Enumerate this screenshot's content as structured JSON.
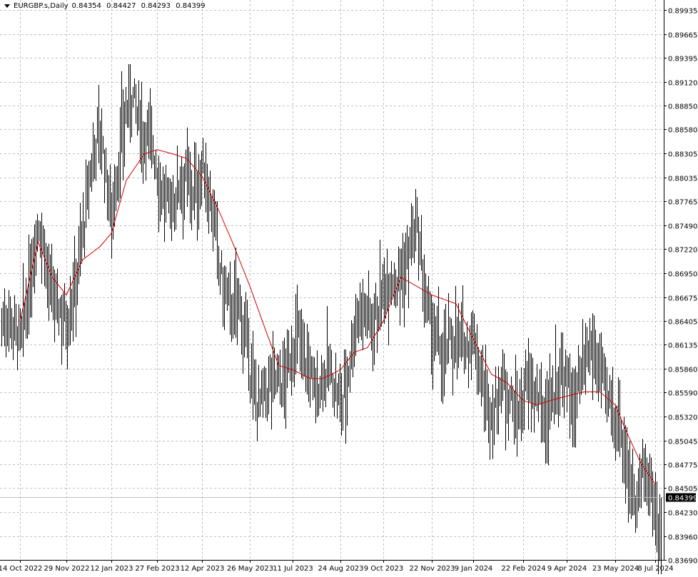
{
  "header": {
    "symbol_label": "EURGBP.s,Daily",
    "open": "0.84354",
    "high": "0.84427",
    "low": "0.84293",
    "close": "0.84399"
  },
  "colors": {
    "background": "#ffffff",
    "grid": "#c0c0c0",
    "bars": "#000000",
    "moving_average": "#d00000",
    "current_price_line": "#c0c0c0",
    "price_label_bg": "#000000",
    "price_label_text": "#ffffff"
  },
  "chart_data": {
    "type": "ohlc",
    "symbol": "EURGBP.s",
    "timeframe": "Daily",
    "grid": true,
    "last_price": 0.84399,
    "ylim": [
      0.8369,
      0.9005
    ],
    "y_ticks": [
      "0.89935",
      "0.89665",
      "0.89395",
      "0.89120",
      "0.88850",
      "0.88580",
      "0.88305",
      "0.88035",
      "0.87765",
      "0.87490",
      "0.87220",
      "0.86950",
      "0.86675",
      "0.86405",
      "0.86135",
      "0.85860",
      "0.85590",
      "0.85320",
      "0.85045",
      "0.84775",
      "0.84505",
      "0.84230",
      "0.83960",
      "0.83690"
    ],
    "x_ticks": [
      "14 Oct 2022",
      "29 Nov 2022",
      "12 Jan 2023",
      "27 Feb 2023",
      "12 Apr 2023",
      "26 May 2023",
      "11 Jul 2023",
      "24 Aug 2023",
      "9 Oct 2023",
      "22 Nov 2023",
      "9 Jan 2024",
      "22 Feb 2024",
      "9 Apr 2024",
      "23 May 2024",
      "8 Jul 2024"
    ],
    "price_points": [
      {
        "date": "14 Oct 2022",
        "price": 0.863
      },
      {
        "date": "1 Nov 2022",
        "price": 0.874
      },
      {
        "date": "15 Nov 2022",
        "price": 0.868
      },
      {
        "date": "29 Nov 2022",
        "price": 0.862
      },
      {
        "date": "15 Dec 2022",
        "price": 0.876
      },
      {
        "date": "1 Jan 2023",
        "price": 0.885
      },
      {
        "date": "12 Jan 2023",
        "price": 0.878
      },
      {
        "date": "3 Feb 2023",
        "price": 0.89
      },
      {
        "date": "14 Feb 2023",
        "price": 0.886
      },
      {
        "date": "27 Feb 2023",
        "price": 0.88
      },
      {
        "date": "15 Mar 2023",
        "price": 0.878
      },
      {
        "date": "28 Mar 2023",
        "price": 0.879
      },
      {
        "date": "12 Apr 2023",
        "price": 0.882
      },
      {
        "date": "26 Apr 2023",
        "price": 0.871
      },
      {
        "date": "10 May 2023",
        "price": 0.866
      },
      {
        "date": "26 May 2023",
        "price": 0.859
      },
      {
        "date": "12 Jun 2023",
        "price": 0.854
      },
      {
        "date": "26 Jun 2023",
        "price": 0.858
      },
      {
        "date": "11 Jul 2023",
        "price": 0.861
      },
      {
        "date": "27 Jul 2023",
        "price": 0.859
      },
      {
        "date": "8 Aug 2023",
        "price": 0.857
      },
      {
        "date": "24 Aug 2023",
        "price": 0.856
      },
      {
        "date": "8 Sep 2023",
        "price": 0.862
      },
      {
        "date": "22 Sep 2023",
        "price": 0.866
      },
      {
        "date": "9 Oct 2023",
        "price": 0.866
      },
      {
        "date": "25 Oct 2023",
        "price": 0.871
      },
      {
        "date": "8 Nov 2023",
        "price": 0.872
      },
      {
        "date": "22 Nov 2023",
        "price": 0.864
      },
      {
        "date": "6 Dec 2023",
        "price": 0.858
      },
      {
        "date": "20 Dec 2023",
        "price": 0.864
      },
      {
        "date": "9 Jan 2024",
        "price": 0.86
      },
      {
        "date": "25 Jan 2024",
        "price": 0.855
      },
      {
        "date": "8 Feb 2024",
        "price": 0.855
      },
      {
        "date": "22 Feb 2024",
        "price": 0.856
      },
      {
        "date": "8 Mar 2024",
        "price": 0.854
      },
      {
        "date": "22 Mar 2024",
        "price": 0.856
      },
      {
        "date": "9 Apr 2024",
        "price": 0.856
      },
      {
        "date": "25 Apr 2024",
        "price": 0.858
      },
      {
        "date": "9 May 2024",
        "price": 0.86
      },
      {
        "date": "23 May 2024",
        "price": 0.852
      },
      {
        "date": "7 Jun 2024",
        "price": 0.847
      },
      {
        "date": "21 Jun 2024",
        "price": 0.846
      },
      {
        "date": "8 Jul 2024",
        "price": 0.842
      },
      {
        "date": "24 Jul 2024",
        "price": 0.843
      }
    ],
    "moving_average": [
      {
        "date": "14 Oct 2022",
        "price": 0.864
      },
      {
        "date": "1 Nov 2022",
        "price": 0.873
      },
      {
        "date": "15 Nov 2022",
        "price": 0.869
      },
      {
        "date": "29 Nov 2022",
        "price": 0.867
      },
      {
        "date": "15 Dec 2022",
        "price": 0.871
      },
      {
        "date": "1 Jan 2023",
        "price": 0.8725
      },
      {
        "date": "12 Jan 2023",
        "price": 0.874
      },
      {
        "date": "27 Jan 2023",
        "price": 0.88
      },
      {
        "date": "14 Feb 2023",
        "price": 0.883
      },
      {
        "date": "27 Feb 2023",
        "price": 0.8835
      },
      {
        "date": "15 Mar 2023",
        "price": 0.883
      },
      {
        "date": "28 Mar 2023",
        "price": 0.8825
      },
      {
        "date": "12 Apr 2023",
        "price": 0.8805
      },
      {
        "date": "26 Apr 2023",
        "price": 0.877
      },
      {
        "date": "10 May 2023",
        "price": 0.873
      },
      {
        "date": "26 May 2023",
        "price": 0.868
      },
      {
        "date": "12 Jun 2023",
        "price": 0.863
      },
      {
        "date": "26 Jun 2023",
        "price": 0.859
      },
      {
        "date": "11 Jul 2023",
        "price": 0.8585
      },
      {
        "date": "27 Jul 2023",
        "price": 0.8575
      },
      {
        "date": "8 Aug 2023",
        "price": 0.8575
      },
      {
        "date": "24 Aug 2023",
        "price": 0.8585
      },
      {
        "date": "8 Sep 2023",
        "price": 0.8605
      },
      {
        "date": "22 Sep 2023",
        "price": 0.861
      },
      {
        "date": "9 Oct 2023",
        "price": 0.864
      },
      {
        "date": "25 Oct 2023",
        "price": 0.869
      },
      {
        "date": "8 Nov 2023",
        "price": 0.868
      },
      {
        "date": "22 Nov 2023",
        "price": 0.867
      },
      {
        "date": "6 Dec 2023",
        "price": 0.8665
      },
      {
        "date": "20 Dec 2023",
        "price": 0.866
      },
      {
        "date": "9 Jan 2024",
        "price": 0.862
      },
      {
        "date": "25 Jan 2024",
        "price": 0.858
      },
      {
        "date": "8 Feb 2024",
        "price": 0.857
      },
      {
        "date": "22 Feb 2024",
        "price": 0.855
      },
      {
        "date": "8 Mar 2024",
        "price": 0.8545
      },
      {
        "date": "22 Mar 2024",
        "price": 0.855
      },
      {
        "date": "9 Apr 2024",
        "price": 0.8555
      },
      {
        "date": "25 Apr 2024",
        "price": 0.856
      },
      {
        "date": "9 May 2024",
        "price": 0.856
      },
      {
        "date": "23 May 2024",
        "price": 0.8545
      },
      {
        "date": "7 Jun 2024",
        "price": 0.851
      },
      {
        "date": "21 Jun 2024",
        "price": 0.848
      },
      {
        "date": "8 Jul 2024",
        "price": 0.8455
      }
    ]
  }
}
